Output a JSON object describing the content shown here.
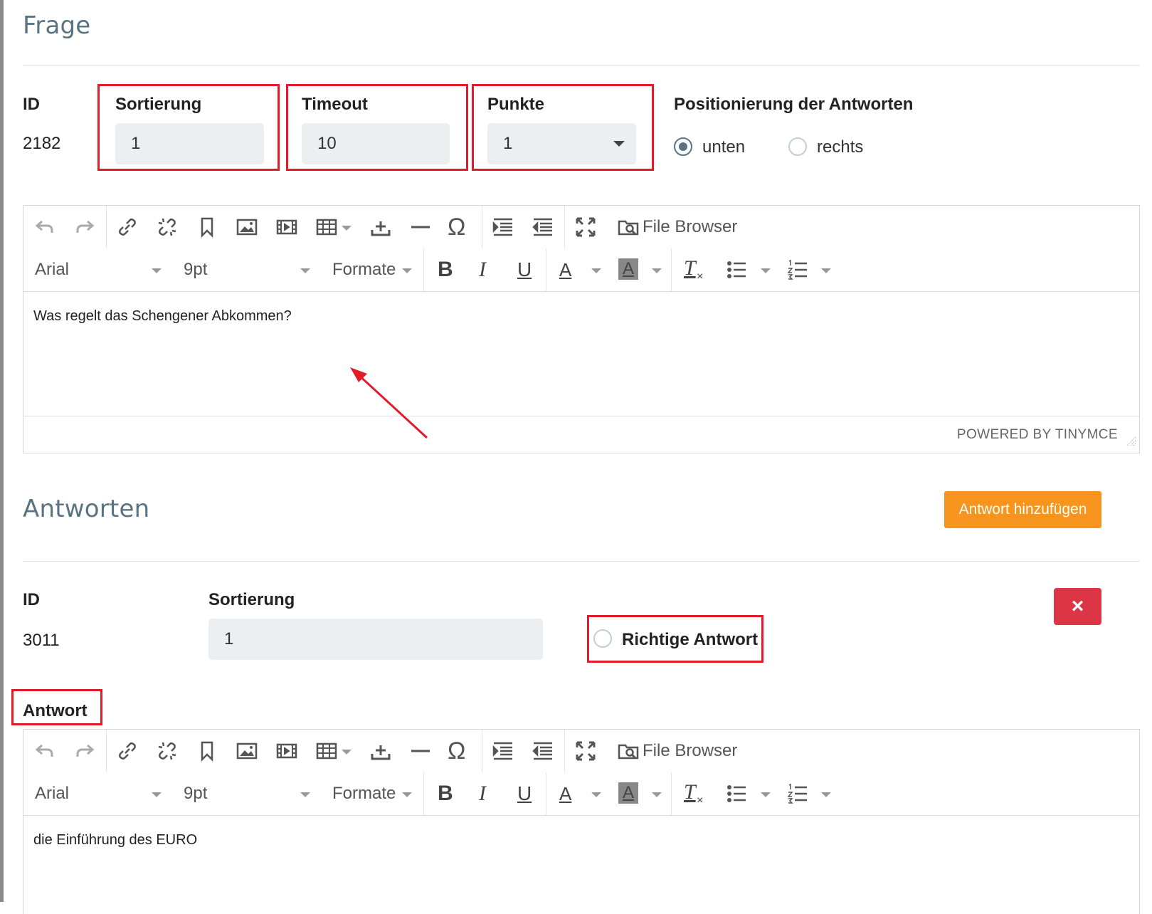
{
  "frage": {
    "title": "Frage",
    "id_label": "ID",
    "id_value": "2182",
    "sortierung_label": "Sortierung",
    "sortierung_value": "1",
    "timeout_label": "Timeout",
    "timeout_value": "10",
    "punkte_label": "Punkte",
    "punkte_value": "1",
    "positionierung_label": "Positionierung der Antworten",
    "positionierung_options": [
      {
        "label": "unten",
        "checked": true
      },
      {
        "label": "rechts",
        "checked": false
      }
    ]
  },
  "editor": {
    "file_browser": "File Browser",
    "font_family": "Arial",
    "font_size": "9pt",
    "formats": "Formate",
    "bold": "B",
    "italic": "I",
    "underline": "U",
    "text_color": "A",
    "bg_color": "A",
    "clear_format": "T",
    "special_char": "Ω",
    "powered_by": "POWERED BY TINYMCE"
  },
  "question_editor": {
    "content": "Was regelt das Schengener Abkommen?"
  },
  "antworten": {
    "title": "Antworten",
    "add_button": "Antwort hinzufügen",
    "delete_button": "×",
    "id_label": "ID",
    "id_value": "3011",
    "sortierung_label": "Sortierung",
    "sortierung_value": "1",
    "richtige_label": "Richtige Antwort",
    "antwort_label": "Antwort",
    "antwort_content": "die Einführung des EURO"
  },
  "colors": {
    "accent": "#5a7383",
    "highlight": "#e21b28",
    "add_button": "#f7941d",
    "delete_button": "#dc3545"
  }
}
